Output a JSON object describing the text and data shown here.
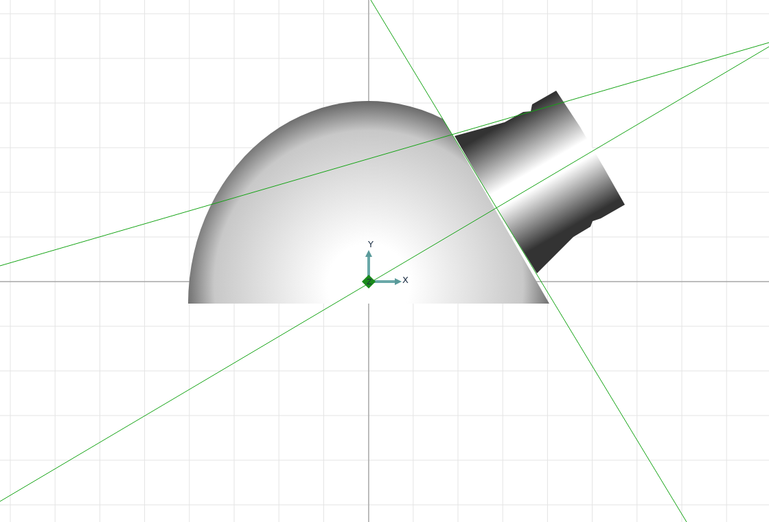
{
  "viewport": {
    "axis_labels": [
      {
        "kind": "y",
        "text": "Y"
      },
      {
        "kind": "z",
        "text": "Z"
      },
      {
        "kind": "x",
        "text": "X"
      }
    ]
  }
}
